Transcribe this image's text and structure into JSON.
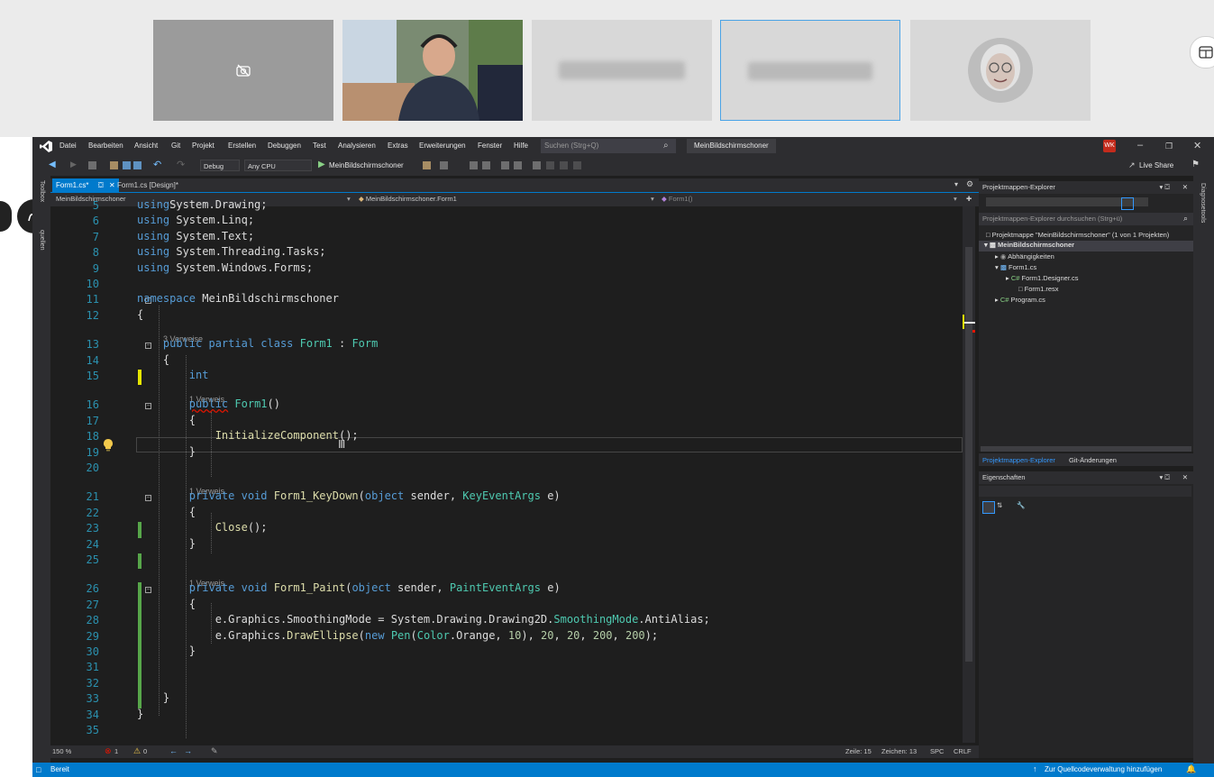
{
  "meeting": {
    "participants": [
      {
        "name": "camera-off-tile",
        "state": "camera-off"
      },
      {
        "name": "video-tile",
        "state": "video"
      },
      {
        "name": "blurred-tile-1",
        "state": "blurred"
      },
      {
        "name": "blurred-tile-2",
        "state": "blurred-selected"
      },
      {
        "name": "avatar-tile",
        "state": "avatar"
      }
    ]
  },
  "vs": {
    "menu": [
      "Datei",
      "Bearbeiten",
      "Ansicht",
      "Git",
      "Projekt",
      "Erstellen",
      "Debuggen",
      "Test",
      "Analysieren",
      "Extras",
      "Erweiterungen",
      "Fenster",
      "Hilfe"
    ],
    "search_placeholder": "Suchen (Strg+Q)",
    "solution_title": "MeinBildschirmschoner",
    "user_badge": "WK",
    "live_share": "Live Share",
    "toolbar": {
      "config": "Debug",
      "platform": "Any CPU",
      "run_target": "MeinBildschirmschoner"
    },
    "left_strip": {
      "toolbox": "Toolbox",
      "sources": "quellen"
    },
    "right_strip": {
      "diag": "Diagnosetools"
    },
    "tabs": [
      {
        "label": "Form1.cs*",
        "active": true
      },
      {
        "label": "Form1.cs [Design]*",
        "active": false
      }
    ],
    "nav": {
      "project": "MeinBildschirmschoner",
      "class": "MeinBildschirmschoner.Form1",
      "member": "Form1()"
    },
    "editor": {
      "lines": [
        {
          "n": "5",
          "code": [
            [
              "kw",
              "using"
            ],
            [
              "",
              "System.Drawing;"
            ]
          ]
        },
        {
          "n": "6",
          "code": [
            [
              "kw",
              "using"
            ],
            [
              "",
              " System.Linq;"
            ]
          ]
        },
        {
          "n": "7",
          "code": [
            [
              "kw",
              "using"
            ],
            [
              "",
              " System.Text;"
            ]
          ]
        },
        {
          "n": "8",
          "code": [
            [
              "kw",
              "using"
            ],
            [
              "",
              " System.Threading.Tasks;"
            ]
          ]
        },
        {
          "n": "9",
          "code": [
            [
              "kw",
              "using"
            ],
            [
              "",
              " System.Windows.Forms;"
            ]
          ]
        },
        {
          "n": "10",
          "code": []
        },
        {
          "n": "11",
          "code": [
            [
              "kw",
              "namespace"
            ],
            [
              "",
              " MeinBildschirmschoner"
            ]
          ]
        },
        {
          "n": "12",
          "code": [
            [
              "",
              "{"
            ]
          ]
        },
        {
          "n": "13",
          "code": [
            [
              "",
              "    "
            ],
            [
              "kw",
              "public partial class"
            ],
            [
              "",
              " "
            ],
            [
              "ty",
              "Form1"
            ],
            [
              "",
              " : "
            ],
            [
              "ty",
              "Form"
            ]
          ]
        },
        {
          "n": "14",
          "code": [
            [
              "",
              "    {"
            ]
          ]
        },
        {
          "n": "15",
          "code": [
            [
              "",
              "        "
            ],
            [
              "kw",
              "int"
            ]
          ]
        },
        {
          "n": "16",
          "code": [
            [
              "",
              "        "
            ],
            [
              "kw",
              "public"
            ],
            [
              "",
              " "
            ],
            [
              "ty",
              "Form1"
            ],
            [
              "",
              "()"
            ]
          ]
        },
        {
          "n": "17",
          "code": [
            [
              "",
              "        {"
            ]
          ]
        },
        {
          "n": "18",
          "code": [
            [
              "",
              "            "
            ],
            [
              "mt",
              "InitializeComponent"
            ],
            [
              "",
              "();"
            ]
          ]
        },
        {
          "n": "19",
          "code": [
            [
              "",
              "        }"
            ]
          ]
        },
        {
          "n": "20",
          "code": []
        },
        {
          "n": "21",
          "code": [
            [
              "",
              "        "
            ],
            [
              "kw",
              "private void"
            ],
            [
              "",
              " "
            ],
            [
              "mt",
              "Form1_KeyDown"
            ],
            [
              "",
              "("
            ],
            [
              "kw",
              "object"
            ],
            [
              "",
              " sender, "
            ],
            [
              "ty",
              "KeyEventArgs"
            ],
            [
              "",
              " e)"
            ]
          ]
        },
        {
          "n": "22",
          "code": [
            [
              "",
              "        {"
            ]
          ]
        },
        {
          "n": "23",
          "code": [
            [
              "",
              "            "
            ],
            [
              "mt",
              "Close"
            ],
            [
              "",
              "();"
            ]
          ]
        },
        {
          "n": "24",
          "code": [
            [
              "",
              "        }"
            ]
          ]
        },
        {
          "n": "25",
          "code": []
        },
        {
          "n": "26",
          "code": [
            [
              "",
              "        "
            ],
            [
              "kw",
              "private void"
            ],
            [
              "",
              " "
            ],
            [
              "mt",
              "Form1_Paint"
            ],
            [
              "",
              "("
            ],
            [
              "kw",
              "object"
            ],
            [
              "",
              " sender, "
            ],
            [
              "ty",
              "PaintEventArgs"
            ],
            [
              "",
              " e)"
            ]
          ]
        },
        {
          "n": "27",
          "code": [
            [
              "",
              "        {"
            ]
          ]
        },
        {
          "n": "28",
          "code": [
            [
              "",
              "            e.Graphics.SmoothingMode = System.Drawing.Drawing2D."
            ],
            [
              "ty",
              "SmoothingMode"
            ],
            [
              "",
              ".AntiAlias;"
            ]
          ]
        },
        {
          "n": "29",
          "code": [
            [
              "",
              "            e.Graphics."
            ],
            [
              "mt",
              "DrawEllipse"
            ],
            [
              "",
              "("
            ],
            [
              "kw",
              "new"
            ],
            [
              "",
              " "
            ],
            [
              "ty",
              "Pen"
            ],
            [
              "",
              "("
            ],
            [
              "ty",
              "Color"
            ],
            [
              "",
              ".Orange, "
            ],
            [
              "nm",
              "10"
            ],
            [
              "",
              "), "
            ],
            [
              "nm",
              "20"
            ],
            [
              "",
              ", "
            ],
            [
              "nm",
              "20"
            ],
            [
              "",
              ", "
            ],
            [
              "nm",
              "200"
            ],
            [
              "",
              ", "
            ],
            [
              "nm",
              "200"
            ],
            [
              "",
              ");"
            ]
          ]
        },
        {
          "n": "30",
          "code": [
            [
              "",
              "        }"
            ]
          ]
        },
        {
          "n": "31",
          "code": []
        },
        {
          "n": "32",
          "code": []
        },
        {
          "n": "33",
          "code": [
            [
              "",
              "    }"
            ]
          ]
        },
        {
          "n": "34",
          "code": [
            [
              "",
              "}"
            ]
          ]
        },
        {
          "n": "35",
          "code": []
        }
      ],
      "lenses": [
        {
          "before": "13",
          "text": "3 Verweise"
        },
        {
          "before": "16",
          "text": "1 Verweis"
        },
        {
          "before": "21",
          "text": "1 Verweis"
        },
        {
          "before": "26",
          "text": "1 Verweis"
        }
      ]
    },
    "status_row": {
      "zoom": "150 %",
      "errors": "1",
      "warnings": "0",
      "line": "Zeile: 15",
      "char": "Zeichen: 13",
      "spc": "SPC",
      "crlf": "CRLF"
    },
    "status_bar": {
      "ready": "Bereit",
      "source_control": "Zur Quellcodeverwaltung hinzufügen"
    },
    "solution_explorer": {
      "title": "Projektmappen-Explorer",
      "search_placeholder": "Projektmappen-Explorer durchsuchen (Strg+ü)",
      "items": [
        "Projektmappe \"MeinBildschirmschoner\" (1 von 1 Projekten)",
        "MeinBildschirmschoner",
        "Abhängigkeiten",
        "Form1.cs",
        "Form1.Designer.cs",
        "Form1.resx",
        "Program.cs"
      ],
      "tabs": [
        "Projektmappen-Explorer",
        "Git-Änderungen"
      ]
    },
    "properties": {
      "title": "Eigenschaften"
    }
  }
}
